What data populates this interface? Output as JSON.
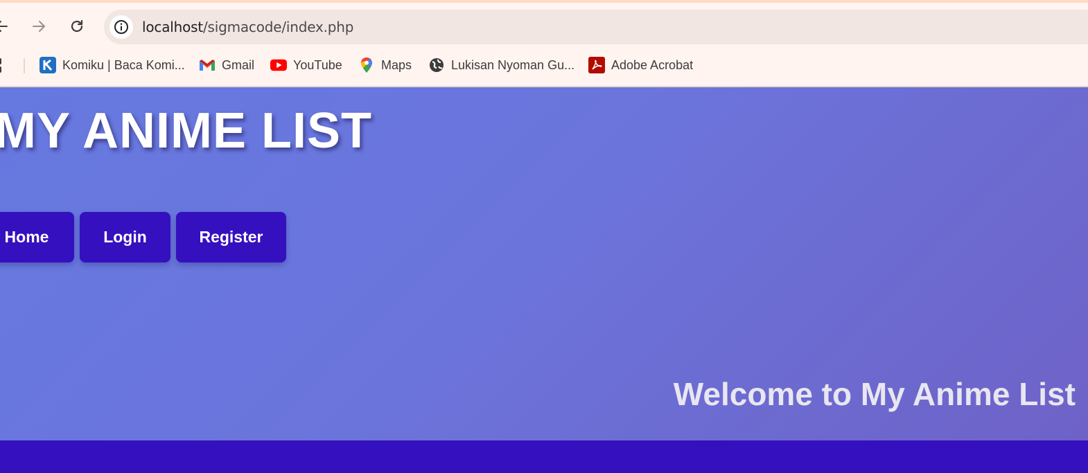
{
  "browser": {
    "url_host": "localhost",
    "url_path": "/sigmacode/index.php",
    "bookmarks": [
      {
        "label": "Komiku | Baca Komi...",
        "icon": "komiku-icon"
      },
      {
        "label": "Gmail",
        "icon": "gmail-icon"
      },
      {
        "label": "YouTube",
        "icon": "youtube-icon"
      },
      {
        "label": "Maps",
        "icon": "maps-icon"
      },
      {
        "label": "Lukisan Nyoman Gu...",
        "icon": "globe-icon"
      },
      {
        "label": "Adobe Acrobat",
        "icon": "acrobat-icon"
      }
    ]
  },
  "page": {
    "title": "MY ANIME LIST",
    "nav": [
      {
        "label": "Home"
      },
      {
        "label": "Login"
      },
      {
        "label": "Register"
      }
    ],
    "welcome": "Welcome to My Anime List"
  },
  "colors": {
    "nav_button": "#3510bf",
    "footer": "#3510bf",
    "gradient_start": "#6679e0",
    "gradient_end": "#6e62c7",
    "chrome_bg": "#fff4f0",
    "omnibox_bg": "#f2e6e2"
  }
}
